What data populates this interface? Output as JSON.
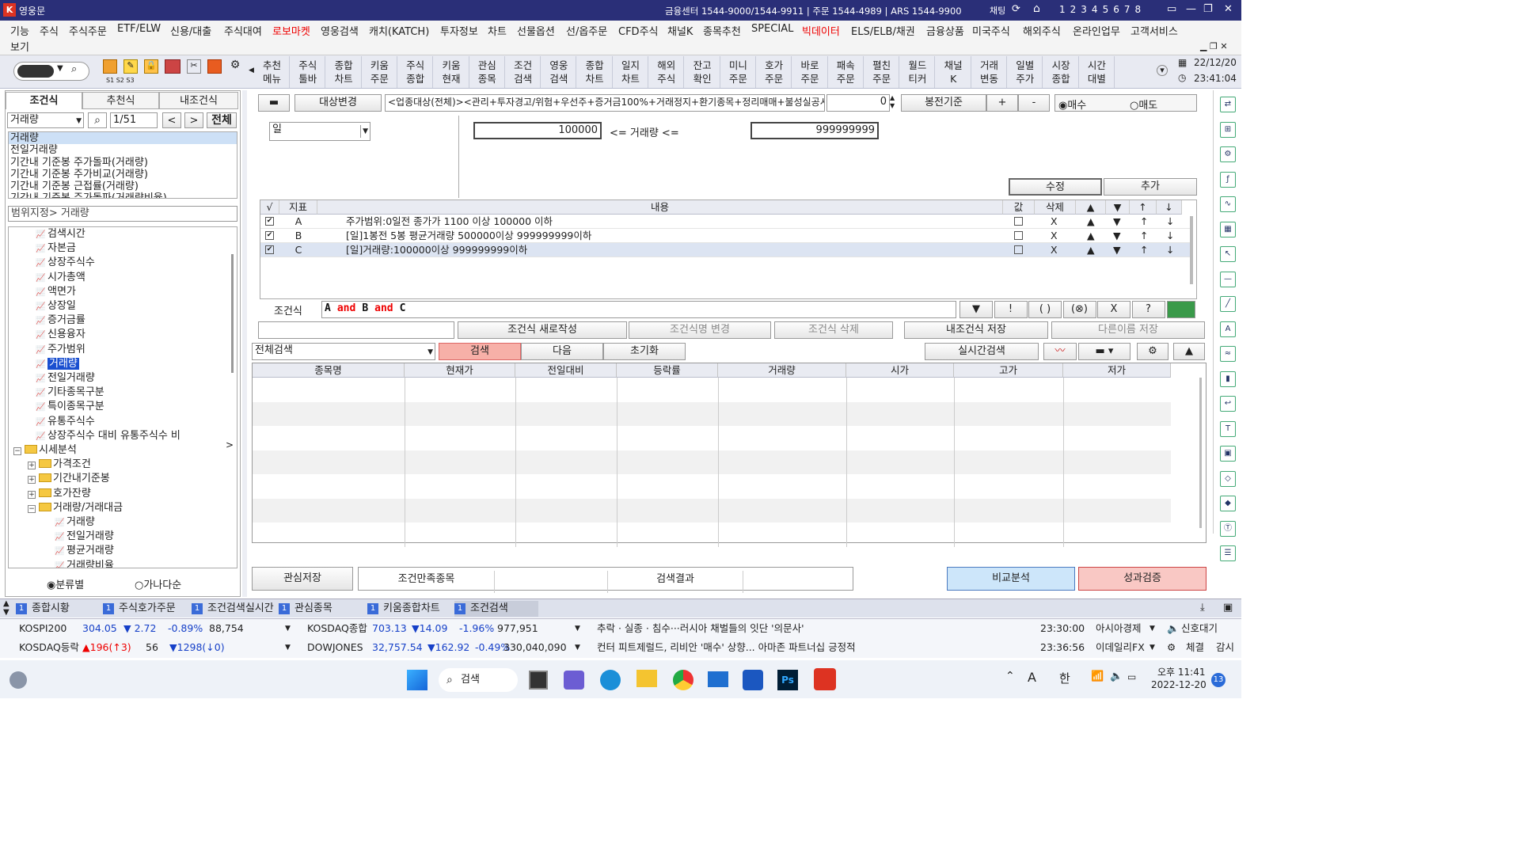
{
  "titlebar": {
    "app_name": "영웅문",
    "contact": "금융센터 1544-9000/1544-9911 | 주문 1544-4989 | ARS 1544-9900",
    "chat": "채팅",
    "screen_nums": [
      "1",
      "2",
      "3",
      "4",
      "5",
      "6",
      "7",
      "8"
    ]
  },
  "menu": [
    "기능",
    "주식",
    "주식주문",
    "ETF/ELW",
    "신용/대출",
    "주식대여",
    "로보마켓",
    "영웅검색",
    "캐치(KATCH)",
    "투자정보",
    "차트",
    "선물옵션",
    "선/옵주문",
    "CFD주식",
    "채널K",
    "종목추천",
    "SPECIAL",
    "빅데이터",
    "ELS/ELB/채권",
    "금융상품",
    "미국주식",
    "해외주식",
    "온라인업무",
    "고객서비스"
  ],
  "menu2": "보기",
  "toolbar": {
    "items": [
      "추천\n메뉴",
      "주식\n툴바",
      "종합\n차트",
      "키움\n주문",
      "주식\n종합",
      "키움\n현재",
      "관심\n종목",
      "조건\n검색",
      "영웅\n검색",
      "종합\n차트",
      "일지\n차트",
      "해외\n주식",
      "잔고\n확인",
      "미니\n주문",
      "호가\n주문",
      "바로\n주문",
      "패속\n주문",
      "펼친\n주문",
      "월드\n티커",
      "채널\nK",
      "거래\n변동",
      "일별\n주가",
      "시장\n종합",
      "시간\n대별"
    ],
    "date": "22/12/20",
    "time": "23:41:04",
    "shots": [
      "S1",
      "S2",
      "S3"
    ]
  },
  "left": {
    "tabs": [
      "조건식",
      "추천식",
      "내조건식"
    ],
    "search_value": "거래량",
    "page": "1/51",
    "all_btn": "전체",
    "list": [
      "거래량",
      "전일거래량",
      "기간내 기준봉 주가돌파(거래량)",
      "기간내 기준봉 주가비교(거래량)",
      "기간내 기준봉 근접률(거래량)",
      "기간내 기준봉 주가돌파(거래량비율)"
    ],
    "range_label": "범위지정> 거래량",
    "tree": [
      "검색시간",
      "자본금",
      "상장주식수",
      "시가총액",
      "액면가",
      "상장일",
      "증거금률",
      "신용융자",
      "주가범위",
      "거래량",
      "전일거래량",
      "기타종목구분",
      "특이종목구분",
      "유통주식수",
      "상장주식수 대비 유통주식수 비"
    ],
    "tree_groups": [
      "시세분석",
      "가격조건",
      "기간내기준봉",
      "호가잔량",
      "거래량/거래대금"
    ],
    "tree_sub": [
      "거래량",
      "전일거래량",
      "평균거래량",
      "거래량비율"
    ],
    "radio1": "분류별",
    "radio2": "가나다순"
  },
  "main": {
    "target_btn": "대상변경",
    "target_text": "<업종대상(전체)><관리+투자경고/위험+우선주+증거금100%+거래정지+환기종목+정리매매+불성실공시",
    "offset": "0",
    "bong": "봉전기준",
    "plus": "+",
    "minus": "-",
    "buy": "매수",
    "sell": "매도",
    "period": "일",
    "min": "100000",
    "mid": "<= 거래량 <=",
    "max": "999999999",
    "edit_btn": "수정",
    "add_btn": "추가",
    "cond_headers": [
      "√",
      "지표",
      "내용",
      "값",
      "삭제",
      "▲",
      "▼",
      "↑",
      "↓"
    ],
    "conditions": [
      {
        "id": "A",
        "text": "주가범위:0일전 종가가 1100 이상 100000 이하"
      },
      {
        "id": "B",
        "text": "[일]1봉전 5봉 평균거래량 500000이상 999999999이하"
      },
      {
        "id": "C",
        "text": "[일]거래량:100000이상 999999999이하"
      }
    ],
    "expr_label": "조건식",
    "expr": "A and B and C",
    "expr_btns": [
      "▼",
      "!",
      "( )",
      "(⊗)",
      "X",
      "?"
    ],
    "action_btns": [
      "조건식 새로작성",
      "조건식명 변경",
      "조건식 삭제",
      "내조건식 저장",
      "다른이름 저장"
    ],
    "search_scope": "전체검색",
    "search_btn": "검색",
    "next_btn": "다음",
    "reset_btn": "초기화",
    "realtime_btn": "실시간검색",
    "result_headers": [
      "종목명",
      "현재가",
      "전일대비",
      "등락률",
      "거래량",
      "시가",
      "고가",
      "저가"
    ],
    "interest_btn": "관심저장",
    "result_tabs": [
      "조건만족종목",
      "검색결과"
    ],
    "compare_btn": "비교분석",
    "perf_btn": "성과검증"
  },
  "bottom_tabs": [
    {
      "n": "1",
      "label": "종합시황"
    },
    {
      "n": "1",
      "label": "주식호가주문"
    },
    {
      "n": "1",
      "label": "조건검색실시간"
    },
    {
      "n": "1",
      "label": "관심종목"
    },
    {
      "n": "1",
      "label": "키움종합차트"
    },
    {
      "n": "1",
      "label": "조건검색"
    }
  ],
  "ticker": {
    "r1": {
      "name": "KOSPI200",
      "val": "304.05",
      "chg": "▼ 2.72",
      "pct": "-0.89%",
      "vol": "88,754",
      "name2": "KOSDAQ종합",
      "val2": "703.13",
      "chg2": "▼14.09",
      "pct2": "-1.96%",
      "vol2": "977,951",
      "news": "추락 · 실종 · 침수···러시아 채벌들의 잇단 '의문사'",
      "time": "23:30:00",
      "src": "아시아경제",
      "signal": "신호대기"
    },
    "r2": {
      "name": "KOSDAQ등락",
      "up": "▲196(↑3)",
      "flat": "56",
      "down": "▼1298(↓0)",
      "name2": "DOWJONES",
      "val2": "32,757.54",
      "chg2": "▼162.92",
      "pct2": "-0.49%",
      "vol2": "330,040,090",
      "news": "컨터 피트제럴드, 리비안 '매수' 상향... 아마존 파트너십 긍정적",
      "time": "23:36:56",
      "src": "이데일리FX",
      "fill": "체결",
      "watch": "감시"
    }
  },
  "taskbar": {
    "search": "검색",
    "ampm": "오후 11:41",
    "date": "2022-12-20",
    "badge": "13",
    "ime": "한",
    "a": "A"
  }
}
